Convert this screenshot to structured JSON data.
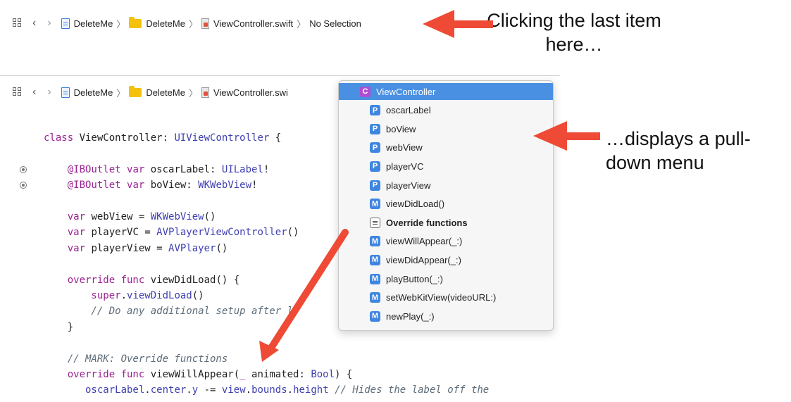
{
  "jumpbar_top": {
    "crumbs": [
      "DeleteMe",
      "DeleteMe",
      "ViewController.swift",
      "No Selection"
    ]
  },
  "jumpbar_inner": {
    "crumbs": [
      "DeleteMe",
      "DeleteMe",
      "ViewController.swi"
    ]
  },
  "callouts": {
    "first": "Clicking the last item here…",
    "second": "…displays a pull-down menu"
  },
  "colors": {
    "accent": "#4a90e2",
    "arrow": "#ee4a35",
    "keyword": "#9b2393",
    "type": "#3e3fb1",
    "comment": "#5d6c79"
  },
  "code_lines": [
    [
      {
        "t": "class ",
        "c": "kw"
      },
      {
        "t": "ViewController: ",
        "c": "pl"
      },
      {
        "t": "UIViewController",
        "c": "ty"
      },
      {
        "t": " {",
        "c": "pl"
      }
    ],
    [],
    [
      {
        "t": "    @IBOutlet ",
        "c": "kw"
      },
      {
        "t": "var ",
        "c": "kw"
      },
      {
        "t": "oscarLabel: ",
        "c": "pl"
      },
      {
        "t": "UILabel",
        "c": "ty"
      },
      {
        "t": "!",
        "c": "pl"
      }
    ],
    [
      {
        "t": "    @IBOutlet ",
        "c": "kw"
      },
      {
        "t": "var ",
        "c": "kw"
      },
      {
        "t": "boView: ",
        "c": "pl"
      },
      {
        "t": "WKWebView",
        "c": "ty"
      },
      {
        "t": "!",
        "c": "pl"
      }
    ],
    [],
    [
      {
        "t": "    var ",
        "c": "kw"
      },
      {
        "t": "webView = ",
        "c": "pl"
      },
      {
        "t": "WKWebView",
        "c": "ty"
      },
      {
        "t": "()",
        "c": "pl"
      }
    ],
    [
      {
        "t": "    var ",
        "c": "kw"
      },
      {
        "t": "playerVC = ",
        "c": "pl"
      },
      {
        "t": "AVPlayerViewController",
        "c": "ty"
      },
      {
        "t": "()",
        "c": "pl"
      }
    ],
    [
      {
        "t": "    var ",
        "c": "kw"
      },
      {
        "t": "playerView = ",
        "c": "pl"
      },
      {
        "t": "AVPlayer",
        "c": "ty"
      },
      {
        "t": "()",
        "c": "pl"
      }
    ],
    [],
    [
      {
        "t": "    override ",
        "c": "kw"
      },
      {
        "t": "func ",
        "c": "kw"
      },
      {
        "t": "viewDidLoad() {",
        "c": "pl"
      }
    ],
    [
      {
        "t": "        super",
        "c": "kw"
      },
      {
        "t": ".",
        "c": "pl"
      },
      {
        "t": "viewDidLoad",
        "c": "fn"
      },
      {
        "t": "()",
        "c": "pl"
      }
    ],
    [
      {
        "t": "        // Do any additional setup after lo",
        "c": "cm"
      }
    ],
    [
      {
        "t": "    }",
        "c": "pl"
      }
    ],
    [],
    [
      {
        "t": "    // MARK: Override functions",
        "c": "cm"
      }
    ],
    [
      {
        "t": "    override ",
        "c": "kw"
      },
      {
        "t": "func ",
        "c": "kw"
      },
      {
        "t": "viewWillAppear(",
        "c": "pl"
      },
      {
        "t": "_ ",
        "c": "kw"
      },
      {
        "t": "animated: ",
        "c": "pl"
      },
      {
        "t": "Bool",
        "c": "ty"
      },
      {
        "t": ") {",
        "c": "pl"
      }
    ],
    [
      {
        "t": "       oscarLabel",
        "c": "fn"
      },
      {
        "t": ".",
        "c": "pl"
      },
      {
        "t": "center",
        "c": "fn"
      },
      {
        "t": ".",
        "c": "pl"
      },
      {
        "t": "y",
        "c": "fn"
      },
      {
        "t": " -= ",
        "c": "pl"
      },
      {
        "t": "view",
        "c": "fn"
      },
      {
        "t": ".",
        "c": "pl"
      },
      {
        "t": "bounds",
        "c": "fn"
      },
      {
        "t": ".",
        "c": "pl"
      },
      {
        "t": "height",
        "c": "fn"
      },
      {
        "t": " // Hides the label off the",
        "c": "cm"
      }
    ]
  ],
  "menu": {
    "items": [
      {
        "badge": "C",
        "kind": "c",
        "label": "ViewController",
        "selected": true,
        "bold": false
      },
      {
        "badge": "P",
        "kind": "p",
        "label": "oscarLabel",
        "selected": false,
        "bold": false
      },
      {
        "badge": "P",
        "kind": "p",
        "label": "boView",
        "selected": false,
        "bold": false
      },
      {
        "badge": "P",
        "kind": "p",
        "label": "webView",
        "selected": false,
        "bold": false
      },
      {
        "badge": "P",
        "kind": "p",
        "label": "playerVC",
        "selected": false,
        "bold": false
      },
      {
        "badge": "P",
        "kind": "p",
        "label": "playerView",
        "selected": false,
        "bold": false
      },
      {
        "badge": "M",
        "kind": "m",
        "label": "viewDidLoad()",
        "selected": false,
        "bold": false
      },
      {
        "badge": "",
        "kind": "mark",
        "label": "Override functions",
        "selected": false,
        "bold": true
      },
      {
        "badge": "M",
        "kind": "m",
        "label": "viewWillAppear(_:)",
        "selected": false,
        "bold": false
      },
      {
        "badge": "M",
        "kind": "m",
        "label": "viewDidAppear(_:)",
        "selected": false,
        "bold": false
      },
      {
        "badge": "M",
        "kind": "m",
        "label": "playButton(_:)",
        "selected": false,
        "bold": false
      },
      {
        "badge": "M",
        "kind": "m",
        "label": "setWebKitView(videoURL:)",
        "selected": false,
        "bold": false
      },
      {
        "badge": "M",
        "kind": "m",
        "label": "newPlay(_:)",
        "selected": false,
        "bold": false
      }
    ]
  }
}
